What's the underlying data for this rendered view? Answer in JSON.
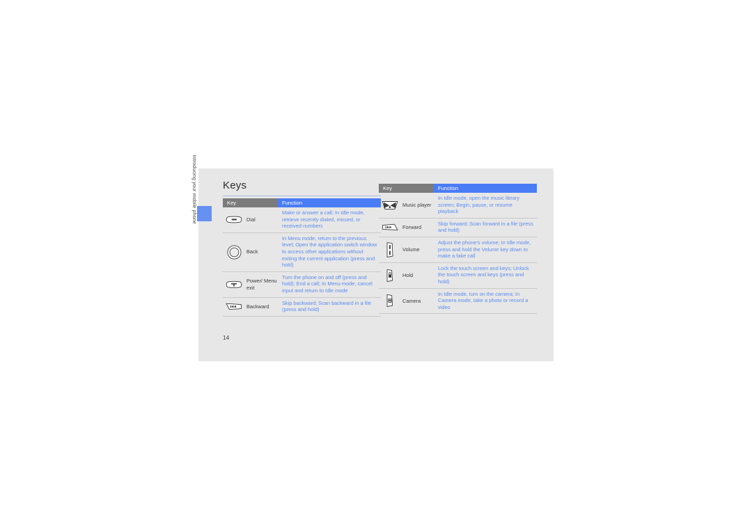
{
  "document": {
    "page_number": "14",
    "section_title": "Keys",
    "side_tab_label": "Introducing your mobile phone",
    "accent_blue": "#4a7cf5",
    "header_gray": "#7b7b7b",
    "body_blue": "#5a8bf0",
    "page_bg": "#e7e7e7"
  },
  "tables": [
    {
      "id": "keys-table-left",
      "columns": [
        "Key",
        "Function"
      ],
      "rows": [
        {
          "icon": "dial-key-icon",
          "key": "Dial",
          "function": "Make or answer a call; In Idle mode, retrieve recently dialed, missed, or received numbers"
        },
        {
          "icon": "back-key-icon",
          "key": "Back",
          "function": "In Menu mode, return to the previous level; Open the application switch window to access other applications without exiting the current application (press and hold)"
        },
        {
          "icon": "power-menu-exit-key-icon",
          "key": "Power/ Menu exit",
          "function": "Turn the phone on and off (press and hold); End a call; In Menu mode, cancel input and return to Idle mode"
        },
        {
          "icon": "backward-key-icon",
          "key": "Backward",
          "function": "Skip backward; Scan backward in a file (press and hold)"
        }
      ]
    },
    {
      "id": "keys-table-right",
      "columns": [
        "Key",
        "Function"
      ],
      "rows": [
        {
          "icon": "music-player-key-icon",
          "key": "Music player",
          "function": "In Idle mode, open the music library screen; Begin, pause, or resume playback"
        },
        {
          "icon": "forward-key-icon",
          "key": "Forward",
          "function": "Skip forward; Scan forward in a file (press and hold)"
        },
        {
          "icon": "volume-key-icon",
          "key": "Volume",
          "function": "Adjust the phone's volume; In Idle mode, press and hold the Volume key down to make a fake call"
        },
        {
          "icon": "hold-key-icon",
          "key": "Hold",
          "function": "Lock the touch screen and keys; Unlock the touch screen and keys (press and hold)"
        },
        {
          "icon": "camera-key-icon",
          "key": "Camera",
          "function": "In Idle mode, turn on the camera; In Camera mode, take a photo or record a video"
        }
      ]
    }
  ]
}
